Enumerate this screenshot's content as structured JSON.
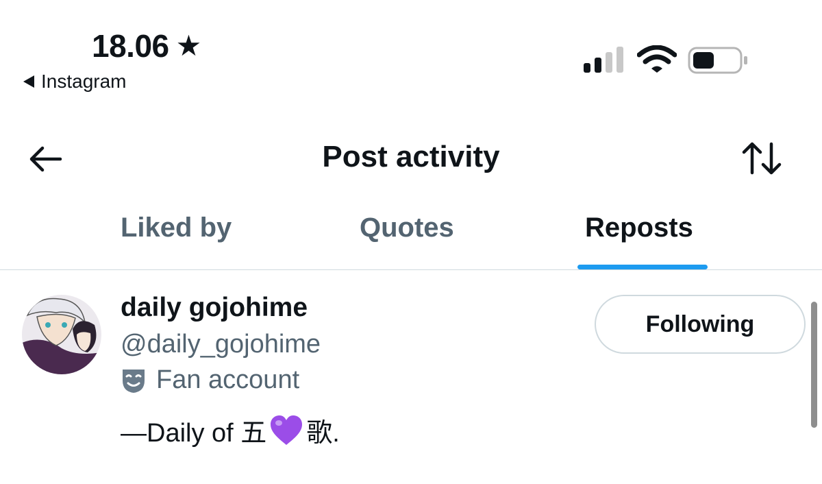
{
  "status_bar": {
    "time": "18.06",
    "back_app_label": "Instagram",
    "icons": [
      "star-icon",
      "cellular-signal-icon",
      "wifi-icon",
      "battery-icon"
    ]
  },
  "header": {
    "title": "Post activity",
    "icons": [
      "back-arrow-icon",
      "sort-icon"
    ]
  },
  "tabs": [
    {
      "label": "Liked by",
      "active": false
    },
    {
      "label": "Quotes",
      "active": false
    },
    {
      "label": "Reposts",
      "active": true
    }
  ],
  "colors": {
    "accent": "#1d9bf0",
    "text_primary": "#0f1419",
    "text_secondary": "#536471",
    "border": "#cfd9de"
  },
  "user": {
    "display_name": "daily gojohime",
    "handle": "@daily_gojohime",
    "label": "Fan account",
    "bio_prefix": "—Daily of 五",
    "bio_suffix": "歌.",
    "follow_button_label": "Following"
  }
}
